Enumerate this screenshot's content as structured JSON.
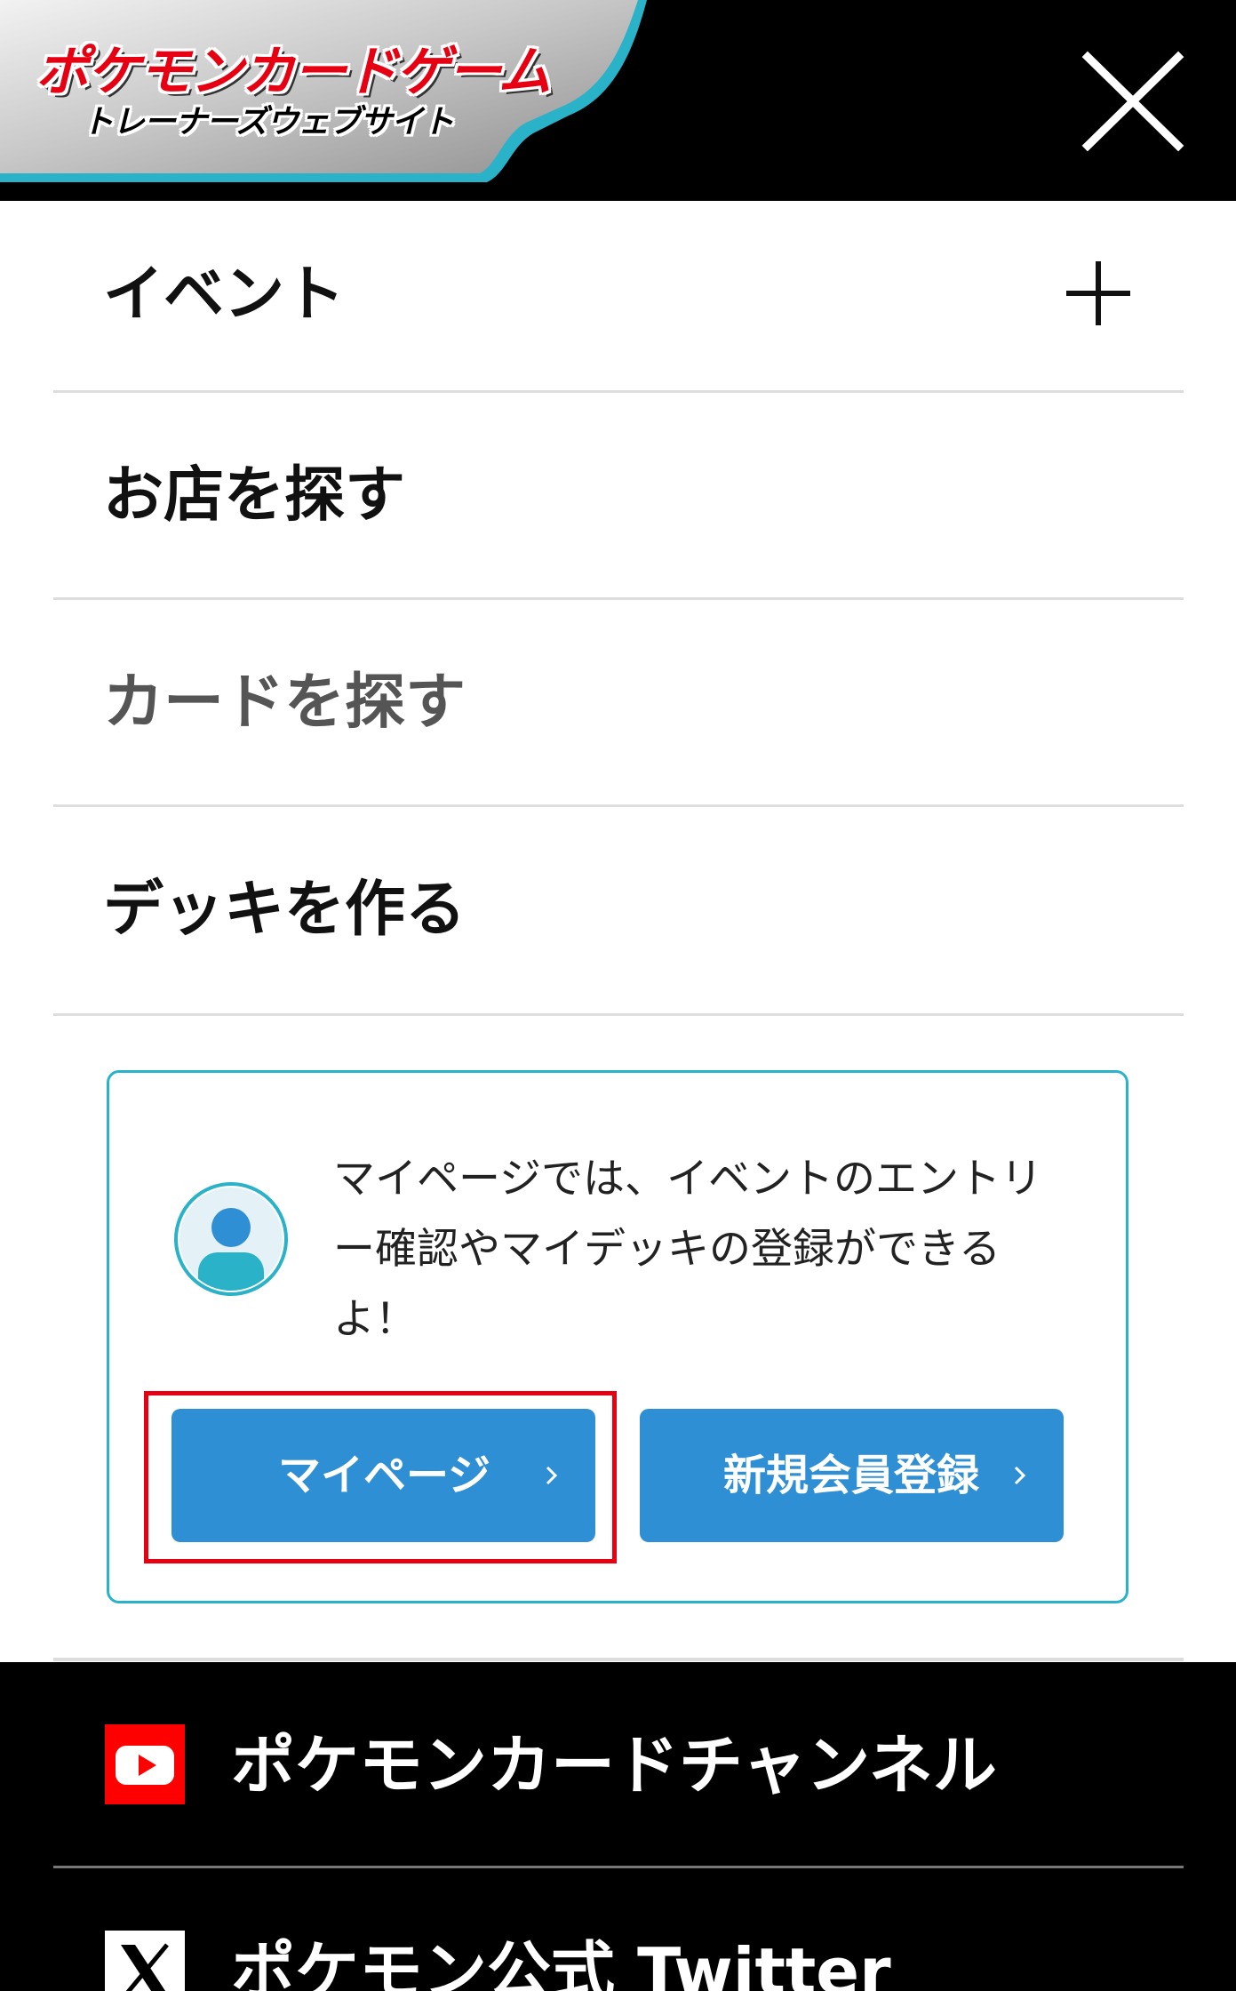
{
  "header": {
    "logo_main": "ポケモンカードゲーム",
    "logo_sub": "トレーナーズウェブサイト",
    "close_icon": "close-icon"
  },
  "menu": {
    "items": [
      {
        "label": "イベント",
        "expandable": true,
        "icon": "plus-icon"
      },
      {
        "label": "お店を探す"
      },
      {
        "label": "カードを探す"
      },
      {
        "label": "デッキを作る"
      }
    ]
  },
  "mypage": {
    "avatar_icon": "user-avatar-icon",
    "description": "マイページでは、イベントのエントリー確認やマイデッキの登録ができるよ！",
    "mypage_button": "マイページ",
    "register_button": "新規会員登録",
    "chevron_icon": "chevron-right-icon",
    "accent_color": "#2f8fd5",
    "border_color": "#2ab2c9",
    "highlight_color": "#e60012"
  },
  "footer": {
    "links": [
      {
        "label": "ポケモンカードチャンネル",
        "icon": "youtube-icon"
      },
      {
        "label": "ポケモン公式 Twitter",
        "icon": "x-twitter-icon"
      }
    ]
  }
}
